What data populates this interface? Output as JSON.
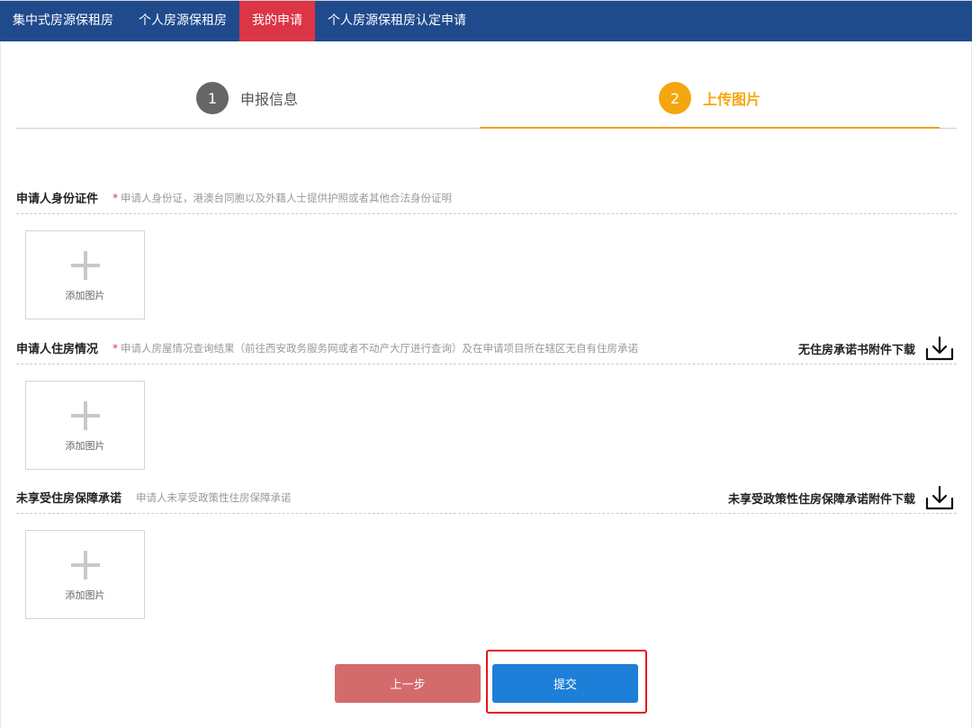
{
  "nav": {
    "tabs": [
      {
        "label": "集中式房源保租房"
      },
      {
        "label": "个人房源保租房"
      },
      {
        "label": "我的申请"
      },
      {
        "label": "个人房源保租房认定申请"
      }
    ]
  },
  "steps": [
    {
      "num": "1",
      "label": "申报信息"
    },
    {
      "num": "2",
      "label": "上传图片"
    }
  ],
  "sections": [
    {
      "title": "申请人身份证件",
      "required_mark": "*",
      "hint": "申请人身份证，港澳台同胞以及外籍人士提供护照或者其他合法身份证明",
      "upload_label": "添加图片"
    },
    {
      "title": "申请人住房情况",
      "required_mark": "*",
      "hint": "申请人房屋情况查询结果（前往西安政务服务网或者不动产大厅进行查询）及在申请项目所在辖区无自有住房承诺",
      "download_label": "无住房承诺书附件下载",
      "upload_label": "添加图片"
    },
    {
      "title": "未享受住房保障承诺",
      "hint": "申请人未享受政策性住房保障承诺",
      "download_label": "未享受政策性住房保障承诺附件下载",
      "upload_label": "添加图片"
    }
  ],
  "buttons": {
    "prev": "上一步",
    "submit": "提交"
  },
  "colors": {
    "nav_bg": "#1f4a8c",
    "nav_active": "#dc3545",
    "step_active": "#f5a60f",
    "prev_button": "#d46b6b",
    "submit_button": "#1e7fd8",
    "highlight": "#e8141b"
  },
  "icons": {
    "download": "download-icon",
    "add": "plus-icon"
  }
}
